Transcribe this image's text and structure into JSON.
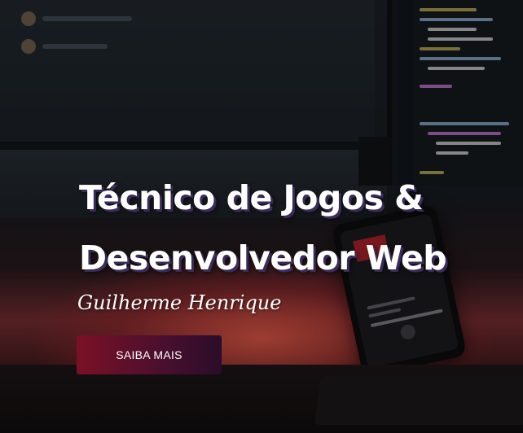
{
  "hero": {
    "title_line1": "Técnico de Jogos &",
    "title_line2": "Desenvolvedor Web",
    "subtitle": "Guilherme Henrique",
    "cta_label": "SAIBA MAIS"
  },
  "colors": {
    "cta_start": "#7a1126",
    "cta_end": "#2a0d2a",
    "title_shadow": "#3a2b5a",
    "text": "#ffffff"
  }
}
